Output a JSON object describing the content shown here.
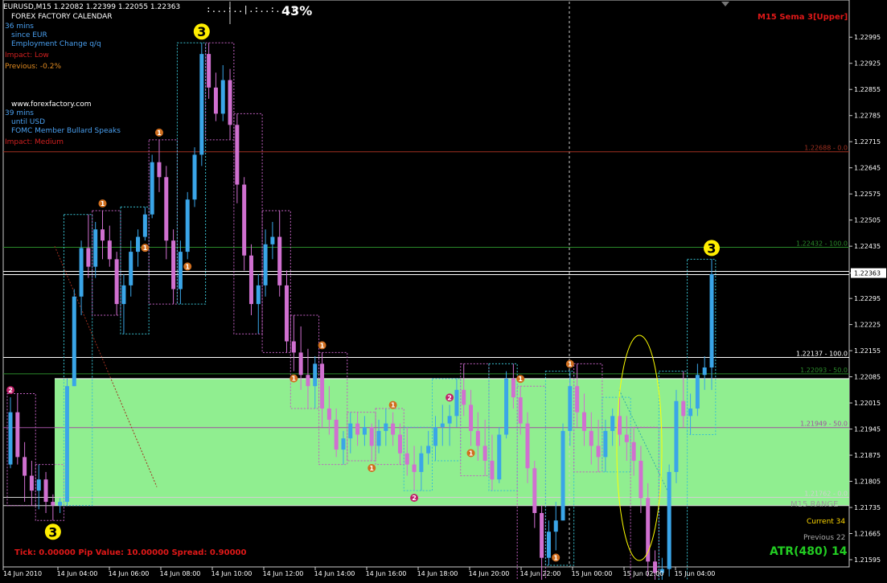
{
  "header": {
    "symbol_line": "EURUSD,M15  1.22082 1.22399 1.22055 1.22363",
    "progress_dots": ":...:..|.:..:...:",
    "progress_pct": "43%",
    "indicator_name": "M15 Sema 3[Upper]"
  },
  "news": {
    "title": "FOREX FACTORY CALENDAR",
    "event1": {
      "time": "36 mins",
      "rel": "since EUR",
      "name": "Employment Change q/q",
      "impact": "Impact: Low",
      "previous": "Previous: -0.2%"
    },
    "site": "www.forexfactory.com",
    "event2": {
      "time": "39 mins",
      "rel": "until USD",
      "name": "FOMC Member Bullard Speaks",
      "impact": "Impact: Medium"
    }
  },
  "info": {
    "tick_line": "Tick: 0.00000 Pip Value: 10.00000 Spread: 0.90000",
    "range_label": "M15 RANGE",
    "current": "Current 34",
    "previous": "Previous 22",
    "atr": "ATR(480) 14"
  },
  "colors": {
    "bull": "#3aa5e8",
    "bear": "#d070d0",
    "zone": "#90ee90",
    "level_red": "#a03020",
    "level_green": "#2a8a2a",
    "text_info": "#4aa0f0",
    "text_red": "#d02020",
    "atr": "#22cc22",
    "marker_orange": "#d06e1e",
    "marker_pink": "#c0206a",
    "marker_yellow": "#ffee00"
  },
  "chart_data": {
    "type": "candlestick",
    "symbol": "EURUSD",
    "timeframe": "M15",
    "ylim": [
      1.21595,
      1.2303
    ],
    "y_ticks": [
      "1.22995",
      "1.22925",
      "1.22855",
      "1.22785",
      "1.22715",
      "1.22645",
      "1.22575",
      "1.22505",
      "1.22435",
      "1.22363",
      "1.22295",
      "1.22225",
      "1.22155",
      "1.22085",
      "1.22015",
      "1.21945",
      "1.21875",
      "1.21805",
      "1.21735",
      "1.21665",
      "1.21595"
    ],
    "x_ticks": [
      "14 Jun 2010",
      "14 Jun 04:00",
      "14 Jun 06:00",
      "14 Jun 08:00",
      "14 Jun 10:00",
      "14 Jun 12:00",
      "14 Jun 14:00",
      "14 Jun 16:00",
      "14 Jun 18:00",
      "14 Jun 20:00",
      "14 Jun 22:00",
      "15 Jun 00:00",
      "15 Jun 02:00",
      "15 Jun 04:00"
    ],
    "current_price": "1.22363",
    "levels": [
      {
        "price": 1.22688,
        "label": "1.22688 - 0.0",
        "color": "#a03020"
      },
      {
        "price": 1.22432,
        "label": "1.22432 - 100.0",
        "color": "#2a8a2a"
      },
      {
        "price": 1.22137,
        "label": "1.22137 - 100.0",
        "color": "#ffffff"
      },
      {
        "price": 1.22093,
        "label": "1.22093 - 50.0",
        "color": "#2a8a2a"
      },
      {
        "price": 1.21949,
        "label": "1.21949 - 50.0",
        "color": "#a050a0"
      },
      {
        "price": 1.21762,
        "label": "1.21762 - 0.0",
        "color": "#d0d0d0"
      }
    ],
    "zone": {
      "from": 1.2174,
      "to": 1.2208
    },
    "candles": [
      [
        1.2185,
        1.2203,
        1.2184,
        1.2199
      ],
      [
        1.2199,
        1.2204,
        1.2185,
        1.2187
      ],
      [
        1.2187,
        1.2191,
        1.2175,
        1.2182
      ],
      [
        1.2182,
        1.2186,
        1.2174,
        1.2178
      ],
      [
        1.2178,
        1.2185,
        1.2173,
        1.2181
      ],
      [
        1.2181,
        1.2183,
        1.2172,
        1.2175
      ],
      [
        1.2175,
        1.2177,
        1.217,
        1.2174
      ],
      [
        1.2174,
        1.2176,
        1.2172,
        1.2175
      ],
      [
        1.2175,
        1.2208,
        1.2174,
        1.2206
      ],
      [
        1.2206,
        1.2232,
        1.2206,
        1.223
      ],
      [
        1.223,
        1.2245,
        1.2225,
        1.2243
      ],
      [
        1.2243,
        1.2252,
        1.2235,
        1.2238
      ],
      [
        1.2238,
        1.225,
        1.2235,
        1.2248
      ],
      [
        1.2248,
        1.2253,
        1.224,
        1.2245
      ],
      [
        1.2245,
        1.2249,
        1.2238,
        1.224
      ],
      [
        1.224,
        1.2242,
        1.2225,
        1.2228
      ],
      [
        1.2228,
        1.2236,
        1.222,
        1.2233
      ],
      [
        1.2233,
        1.2245,
        1.223,
        1.2242
      ],
      [
        1.2242,
        1.2248,
        1.2238,
        1.2246
      ],
      [
        1.2246,
        1.2254,
        1.2245,
        1.2252
      ],
      [
        1.2252,
        1.2268,
        1.2251,
        1.2266
      ],
      [
        1.2266,
        1.2272,
        1.2258,
        1.2262
      ],
      [
        1.2262,
        1.2265,
        1.224,
        1.2245
      ],
      [
        1.2245,
        1.2248,
        1.2228,
        1.2232
      ],
      [
        1.2232,
        1.2245,
        1.2228,
        1.2242
      ],
      [
        1.2242,
        1.2258,
        1.224,
        1.2256
      ],
      [
        1.2256,
        1.227,
        1.2254,
        1.2268
      ],
      [
        1.2268,
        1.2298,
        1.2265,
        1.2295
      ],
      [
        1.2295,
        1.2298,
        1.2283,
        1.2286
      ],
      [
        1.2286,
        1.229,
        1.2277,
        1.2279
      ],
      [
        1.2279,
        1.2292,
        1.2277,
        1.2288
      ],
      [
        1.2288,
        1.2291,
        1.2272,
        1.2276
      ],
      [
        1.2276,
        1.2279,
        1.2255,
        1.226
      ],
      [
        1.226,
        1.2262,
        1.2237,
        1.2241
      ],
      [
        1.2241,
        1.2244,
        1.2225,
        1.2228
      ],
      [
        1.2228,
        1.2236,
        1.222,
        1.2233
      ],
      [
        1.2233,
        1.2248,
        1.223,
        1.2244
      ],
      [
        1.2244,
        1.225,
        1.224,
        1.2246
      ],
      [
        1.2246,
        1.2253,
        1.223,
        1.2233
      ],
      [
        1.2233,
        1.2237,
        1.2215,
        1.2218
      ],
      [
        1.2218,
        1.2225,
        1.221,
        1.2215
      ],
      [
        1.2215,
        1.2222,
        1.2205,
        1.2209
      ],
      [
        1.2209,
        1.2216,
        1.22,
        1.2206
      ],
      [
        1.2206,
        1.2214,
        1.22,
        1.2212
      ],
      [
        1.2212,
        1.2215,
        1.2195,
        1.22
      ],
      [
        1.22,
        1.2206,
        1.2193,
        1.2197
      ],
      [
        1.2197,
        1.22,
        1.2187,
        1.2189
      ],
      [
        1.2189,
        1.2194,
        1.2185,
        1.2192
      ],
      [
        1.2192,
        1.2199,
        1.2188,
        1.2196
      ],
      [
        1.2196,
        1.2199,
        1.219,
        1.2193
      ],
      [
        1.2193,
        1.2198,
        1.219,
        1.2195
      ],
      [
        1.2195,
        1.2196,
        1.2186,
        1.219
      ],
      [
        1.219,
        1.2197,
        1.2188,
        1.2194
      ],
      [
        1.2194,
        1.22,
        1.219,
        1.2196
      ],
      [
        1.2196,
        1.2199,
        1.219,
        1.2193
      ],
      [
        1.2193,
        1.2196,
        1.2185,
        1.2188
      ],
      [
        1.2188,
        1.2195,
        1.2182,
        1.2185
      ],
      [
        1.2185,
        1.219,
        1.2178,
        1.2183
      ],
      [
        1.2183,
        1.219,
        1.2178,
        1.2188
      ],
      [
        1.2188,
        1.2194,
        1.2185,
        1.219
      ],
      [
        1.219,
        1.2198,
        1.2186,
        1.2195
      ],
      [
        1.2195,
        1.2201,
        1.219,
        1.2196
      ],
      [
        1.2196,
        1.2201,
        1.219,
        1.2198
      ],
      [
        1.2198,
        1.2208,
        1.2195,
        1.2205
      ],
      [
        1.2205,
        1.2212,
        1.2198,
        1.2201
      ],
      [
        1.2201,
        1.2205,
        1.219,
        1.2194
      ],
      [
        1.2194,
        1.2199,
        1.2186,
        1.219
      ],
      [
        1.219,
        1.2197,
        1.2182,
        1.2186
      ],
      [
        1.2186,
        1.2193,
        1.2178,
        1.2181
      ],
      [
        1.2181,
        1.2195,
        1.218,
        1.2193
      ],
      [
        1.2193,
        1.221,
        1.2192,
        1.2208
      ],
      [
        1.2208,
        1.2212,
        1.22,
        1.2203
      ],
      [
        1.2203,
        1.2206,
        1.2193,
        1.2196
      ],
      [
        1.2196,
        1.2199,
        1.218,
        1.2184
      ],
      [
        1.2184,
        1.2186,
        1.2168,
        1.2172
      ],
      [
        1.2172,
        1.2174,
        1.2152,
        1.216
      ],
      [
        1.216,
        1.217,
        1.2158,
        1.2167
      ],
      [
        1.2167,
        1.2175,
        1.2162,
        1.217
      ],
      [
        1.217,
        1.2196,
        1.217,
        1.2194
      ],
      [
        1.2194,
        1.221,
        1.219,
        1.2206
      ],
      [
        1.2206,
        1.2212,
        1.2195,
        1.2199
      ],
      [
        1.2199,
        1.2204,
        1.219,
        1.2194
      ],
      [
        1.2194,
        1.2199,
        1.2185,
        1.219
      ],
      [
        1.219,
        1.2197,
        1.2183,
        1.2187
      ],
      [
        1.2187,
        1.2197,
        1.2183,
        1.2194
      ],
      [
        1.2194,
        1.22,
        1.219,
        1.2198
      ],
      [
        1.2198,
        1.2203,
        1.219,
        1.2193
      ],
      [
        1.2193,
        1.2198,
        1.2186,
        1.2191
      ],
      [
        1.2191,
        1.2195,
        1.2182,
        1.2186
      ],
      [
        1.2186,
        1.219,
        1.2172,
        1.2176
      ],
      [
        1.2176,
        1.218,
        1.2155,
        1.2159
      ],
      [
        1.2159,
        1.2162,
        1.215,
        1.2156
      ],
      [
        1.2156,
        1.216,
        1.215,
        1.2157
      ],
      [
        1.2157,
        1.2185,
        1.2155,
        1.2183
      ],
      [
        1.2183,
        1.2205,
        1.218,
        1.2202
      ],
      [
        1.2202,
        1.221,
        1.2195,
        1.2198
      ],
      [
        1.2198,
        1.2204,
        1.2193,
        1.22
      ],
      [
        1.22,
        1.2212,
        1.2198,
        1.2209
      ],
      [
        1.2209,
        1.2214,
        1.2205,
        1.2211
      ],
      [
        1.2211,
        1.224,
        1.2205,
        1.2236
      ]
    ],
    "sema_markers": [
      {
        "i": 6,
        "type": "low",
        "n": "3"
      },
      {
        "i": 27,
        "type": "high",
        "n": "3"
      },
      {
        "i": 99,
        "type": "high",
        "n": "3"
      },
      {
        "i": 90,
        "type": "low",
        "n": "3"
      },
      {
        "i": 0,
        "type": "high",
        "n": "2"
      },
      {
        "i": 62,
        "type": "high",
        "n": "2"
      },
      {
        "i": 57,
        "type": "low",
        "n": "2"
      },
      {
        "i": 13,
        "type": "high",
        "n": "1"
      },
      {
        "i": 21,
        "type": "high",
        "n": "1"
      },
      {
        "i": 19,
        "type": "low",
        "n": "1"
      },
      {
        "i": 25,
        "type": "low",
        "n": "1"
      },
      {
        "i": 40,
        "type": "low",
        "n": "1"
      },
      {
        "i": 44,
        "type": "high",
        "n": "1"
      },
      {
        "i": 51,
        "type": "low",
        "n": "1"
      },
      {
        "i": 54,
        "type": "high",
        "n": "1"
      },
      {
        "i": 65,
        "type": "low",
        "n": "1"
      },
      {
        "i": 72,
        "type": "high",
        "n": "1"
      },
      {
        "i": 79,
        "type": "high",
        "n": "1"
      },
      {
        "i": 77,
        "type": "low",
        "n": "1"
      }
    ]
  }
}
